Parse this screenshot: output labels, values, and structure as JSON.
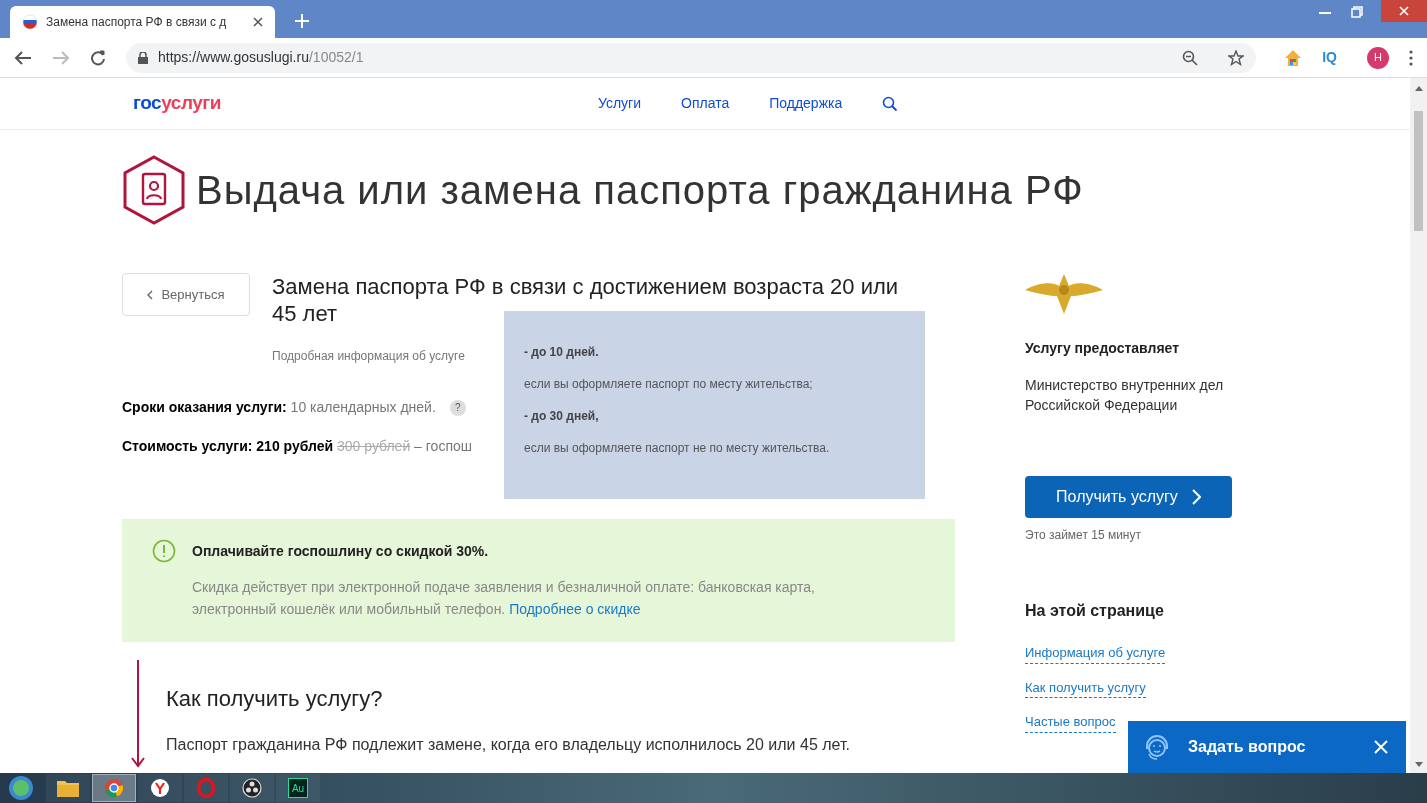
{
  "browser": {
    "tab_title": "Замена паспорта РФ в связи с д",
    "url_host": "https://www.gosuslugi.ru",
    "url_path": "/10052/1",
    "iq": "IQ",
    "profile": "H"
  },
  "site": {
    "logo_first": "гос",
    "logo_second": "услуги",
    "nav": [
      "Услуги",
      "Оплата",
      "Поддержка"
    ]
  },
  "page_title": "Выдача или замена паспорта гражданина РФ",
  "back_button": "Вернуться",
  "service_title": "Замена паспорта РФ в связи с достижением возраста 20 или 45 лет",
  "details_link": "Подробная информация об услуге",
  "terms": {
    "label": "Сроки оказания услуги:",
    "value": "10 календарных дней.",
    "help": "?"
  },
  "cost": {
    "label": "Стоимость услуги: 210 рублей",
    "old_value": "300 рублей",
    "note": "– госпош"
  },
  "tooltip": {
    "lines": [
      {
        "text": "- до 10 дней.",
        "bold": true
      },
      {
        "text": "если вы оформляете паспорт по месту жительства;",
        "bold": false
      },
      {
        "text": "- до 30 дней,",
        "bold": true
      },
      {
        "text": "если вы оформляете паспорт не по месту жительства.",
        "bold": false
      }
    ]
  },
  "notice": {
    "title": "Оплачивайте госпошлину со скидкой 30%.",
    "text": "Скидка действует при электронной подаче заявления и безналичной оплате: банковская карта, электронный кошелёк или мобильный телефон.",
    "link": "Подробнее о скидке"
  },
  "section": {
    "title": "Как получить услугу?",
    "text": "Паспорт гражданина РФ подлежит замене, когда его владельцу исполнилось 20 или 45 лет."
  },
  "sidebar": {
    "provider_heading": "Услугу предоставляет",
    "provider_name": "Министерство внутренних дел Российской Федерации",
    "button": "Получить услугу",
    "duration": "Это займет 15 минут",
    "toc_heading": "На этой странице",
    "toc_links": [
      "Информация об услуге",
      "Как получить услугу",
      "Частые вопрос"
    ]
  },
  "chat": {
    "label": "Задать вопрос"
  },
  "taskbar": {
    "apps": [
      {
        "kind": "folder",
        "selected": false
      },
      {
        "kind": "chrome",
        "selected": true
      },
      {
        "kind": "yandex",
        "selected": false
      },
      {
        "kind": "opera",
        "selected": false
      },
      {
        "kind": "obs",
        "selected": false
      },
      {
        "kind": "audition",
        "selected": false,
        "label": "Au"
      }
    ]
  }
}
